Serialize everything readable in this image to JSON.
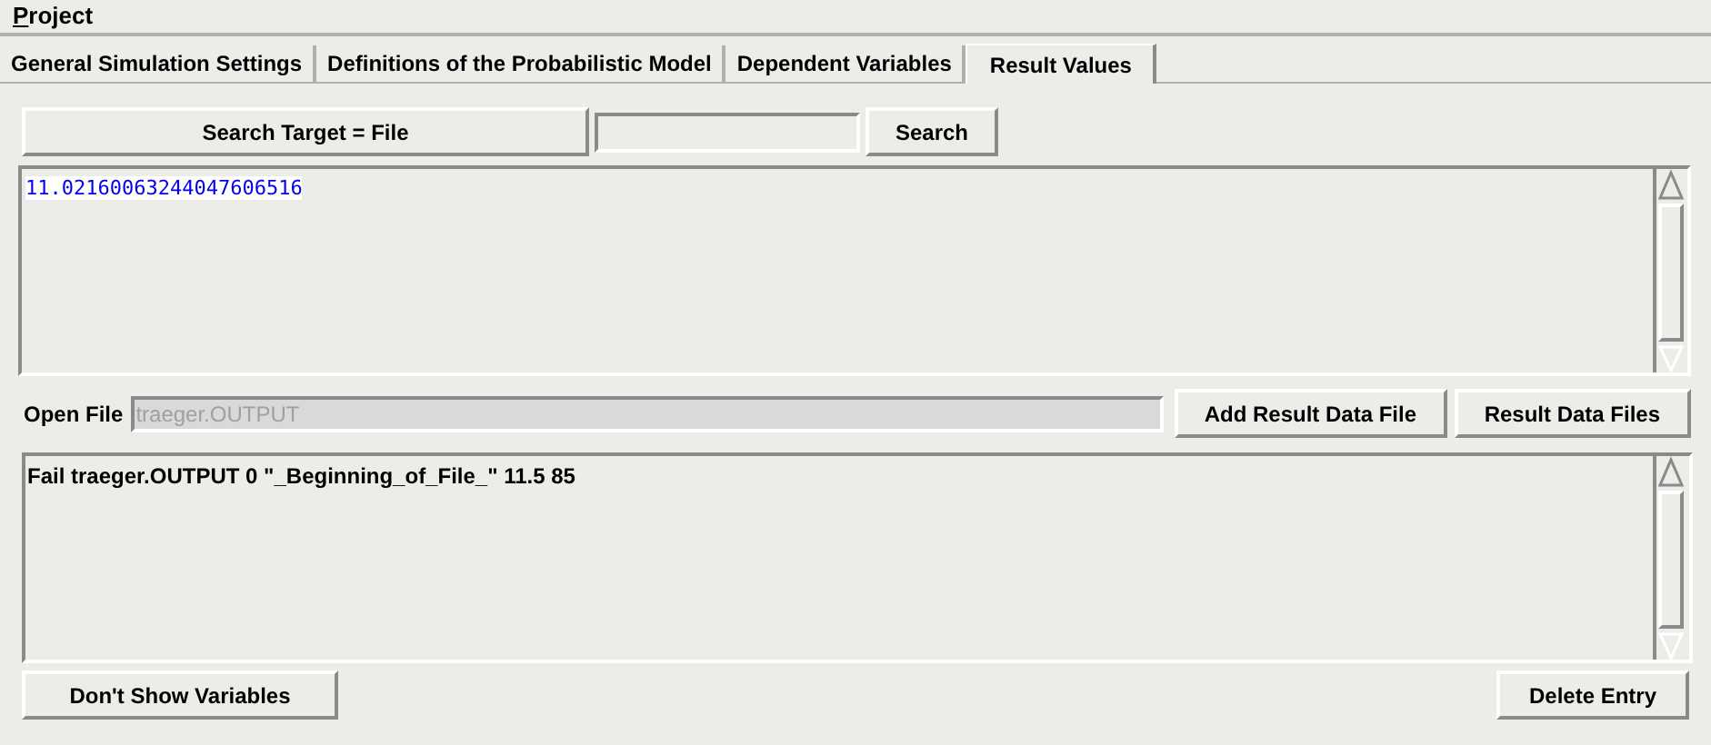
{
  "menu": [
    {
      "label": "Project"
    }
  ],
  "tabs": [
    {
      "label": "General Simulation Settings",
      "selected": false
    },
    {
      "label": "Definitions of the Probabilistic Model",
      "selected": false
    },
    {
      "label": "Dependent Variables",
      "selected": false
    },
    {
      "label": "Result Values",
      "selected": true
    }
  ],
  "search_target_button": "Search Target = File",
  "search_button": "Search",
  "result_text": "11.02160063244047606516",
  "open_file": {
    "label": "Open File",
    "value": "traeger.OUTPUT",
    "disabled": true
  },
  "add_button": "Add Result Data File",
  "files_button": "Result Data Files",
  "entries_text": "Fail traeger.OUTPUT 0 \"_Beginning_of_File_\" 11.5 85",
  "bottom_buttons": [
    "Don't Show Variables",
    "Delete Entry"
  ]
}
